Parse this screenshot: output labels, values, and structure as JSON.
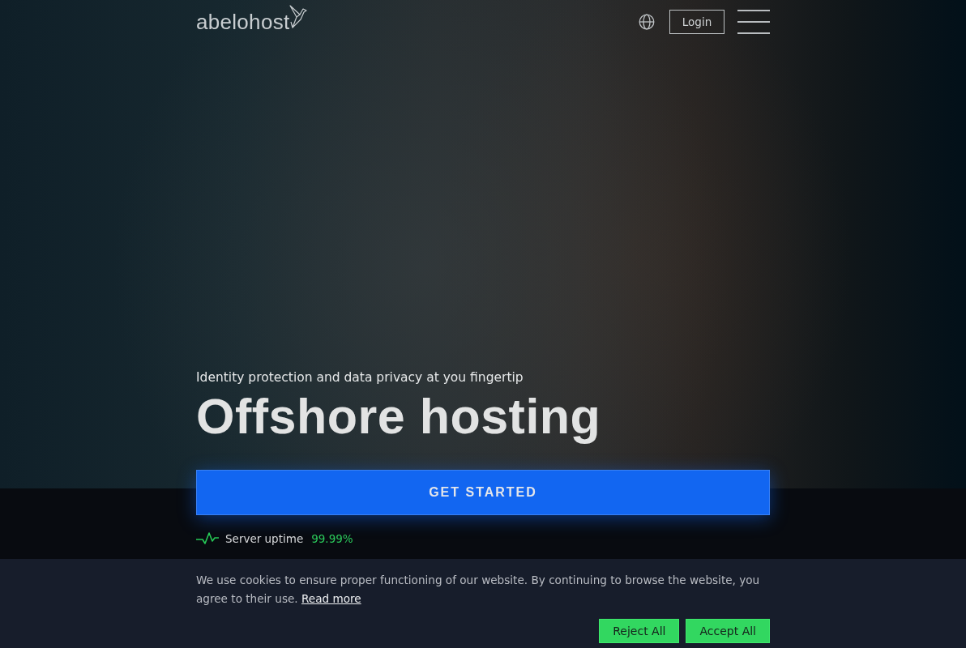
{
  "header": {
    "logo": {
      "text": "abelohost"
    },
    "login": {
      "label": "Login"
    }
  },
  "hero": {
    "subtitle": "Identity protection and data privacy at you fingertip",
    "title": "Offshore hosting",
    "cta": {
      "label": "GET STARTED"
    },
    "uptime": {
      "label": "Server uptime",
      "value": "99.99%"
    }
  },
  "cookie_banner": {
    "text": "We use cookies to ensure proper functioning of our website. By continuing to browse the website, you agree to their use.",
    "link": "Read more",
    "buttons": [
      {
        "label": "Reject All"
      },
      {
        "label": "Accept All"
      }
    ]
  }
}
